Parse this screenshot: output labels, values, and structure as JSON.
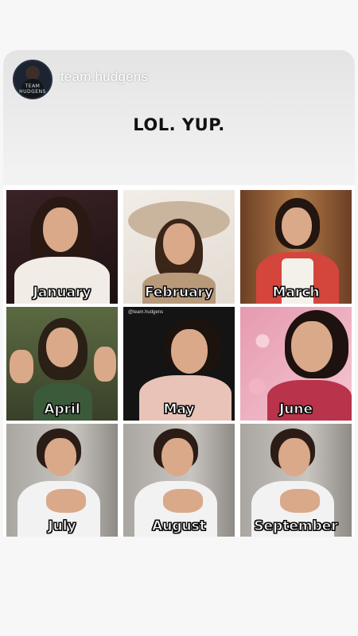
{
  "post": {
    "username": "team.hudgens",
    "avatar_text": "TEAM HUDGENS",
    "caption": "LOL. YUP."
  },
  "months": [
    {
      "label": "January",
      "bg": "#2a1a1c",
      "accent": "#b77a5c",
      "hair": "#2a1812",
      "top": "#f2ece6"
    },
    {
      "label": "February",
      "bg": "#efeae4",
      "accent": "#d6c6b2",
      "hair": "#3a2518",
      "top": "#b89a7a"
    },
    {
      "label": "March",
      "bg": "#7a4a2c",
      "accent": "#c9463f",
      "hair": "#23150f",
      "top": "#d4453c"
    },
    {
      "label": "April",
      "bg": "#4f5a38",
      "accent": "#7a8a5a",
      "hair": "#2a2016",
      "top": "#3a5a3a"
    },
    {
      "label": "May",
      "bg": "#141414",
      "accent": "#e0b9a8",
      "hair": "#1c120e",
      "top": "#e9c3b7",
      "watermark": "@team.hudgens"
    },
    {
      "label": "June",
      "bg": "#e7a8b6",
      "accent": "#f2c9d2",
      "hair": "#1d1210",
      "top": "#b9334a"
    },
    {
      "label": "July",
      "bg": "#bcb9b4",
      "accent": "#9c9892",
      "hair": "#2b1d16",
      "top": "#f2f2f2"
    },
    {
      "label": "August",
      "bg": "#bcb9b4",
      "accent": "#9c9892",
      "hair": "#2b1d16",
      "top": "#f2f2f2"
    },
    {
      "label": "September",
      "bg": "#bcb9b4",
      "accent": "#9c9892",
      "hair": "#2b1d16",
      "top": "#f2f2f2"
    }
  ]
}
